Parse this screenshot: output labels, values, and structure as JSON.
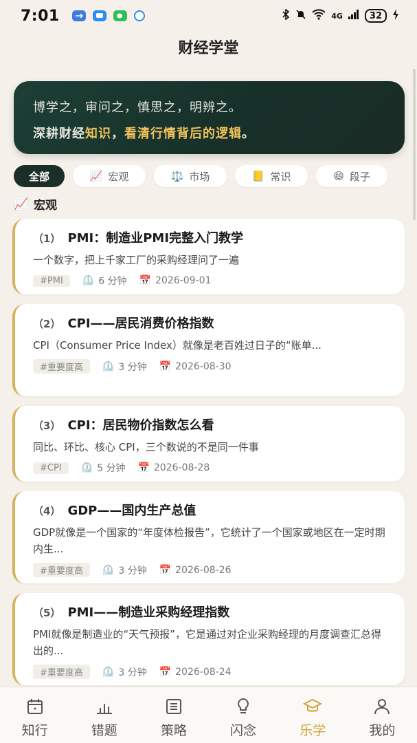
{
  "status_bar": {
    "time": "7:01",
    "network": "4G",
    "battery": "32"
  },
  "page_title": "财经学堂",
  "banner": {
    "line1": "博学之，审问之，慎思之，明辨之。",
    "line2_prefix": "深耕财经",
    "line2_hl1": "知识",
    "line2_mid": "，",
    "line2_hl2": "看清行情背后的逻辑",
    "line2_suffix": "。"
  },
  "chips": [
    {
      "label": "全部",
      "icon": ""
    },
    {
      "label": "宏观",
      "icon": "📈"
    },
    {
      "label": "市场",
      "icon": "⚖️"
    },
    {
      "label": "常识",
      "icon": "📒"
    },
    {
      "label": "段子",
      "icon": "😄"
    }
  ],
  "section": {
    "icon": "📈",
    "label": "宏观"
  },
  "articles": [
    {
      "idx": "（1）",
      "title": "PMI：制造业PMI完整入门教学",
      "desc": "一个数字，把上千家工厂的采购经理问了一遍",
      "tag": "#PMI",
      "read": "6 分钟",
      "date": "2026-09-01"
    },
    {
      "idx": "（2）",
      "title": "CPI——居民消费价格指数",
      "desc": "CPI（Consumer Price Index）就像是老百姓过日子的“账单...",
      "tag": "#重要度高",
      "read": "3 分钟",
      "date": "2026-08-30"
    },
    {
      "idx": "（3）",
      "title": "CPI：居民物价指数怎么看",
      "desc": "同比、环比、核心 CPI，三个数说的不是同一件事",
      "tag": "#CPI",
      "read": "5 分钟",
      "date": "2026-08-28"
    },
    {
      "idx": "（4）",
      "title": "GDP——国内生产总值",
      "desc": "GDP就像是一个国家的“年度体检报告”，它统计了一个国家或地区在一定时期内生...",
      "tag": "#重要度高",
      "read": "3 分钟",
      "date": "2026-08-26"
    },
    {
      "idx": "（5）",
      "title": "PMI——制造业采购经理指数",
      "desc": "PMI就像是制造业的“天气预报”，它是通过对企业采购经理的月度调查汇总得出的...",
      "tag": "#重要度高",
      "read": "3 分钟",
      "date": "2026-08-24"
    }
  ],
  "bottom_nav": [
    {
      "label": "知行",
      "icon": "calendar-icon"
    },
    {
      "label": "错题",
      "icon": "bar-chart-icon"
    },
    {
      "label": "策略",
      "icon": "list-icon"
    },
    {
      "label": "闪念",
      "icon": "lightbulb-icon"
    },
    {
      "label": "乐学",
      "icon": "graduation-cap-icon"
    },
    {
      "label": "我的",
      "icon": "person-icon"
    }
  ],
  "colors": {
    "accent": "#d4a23a",
    "banner_bg": "#1c3f36",
    "highlight": "#f2c25a",
    "card_border": "#d6b25e"
  }
}
